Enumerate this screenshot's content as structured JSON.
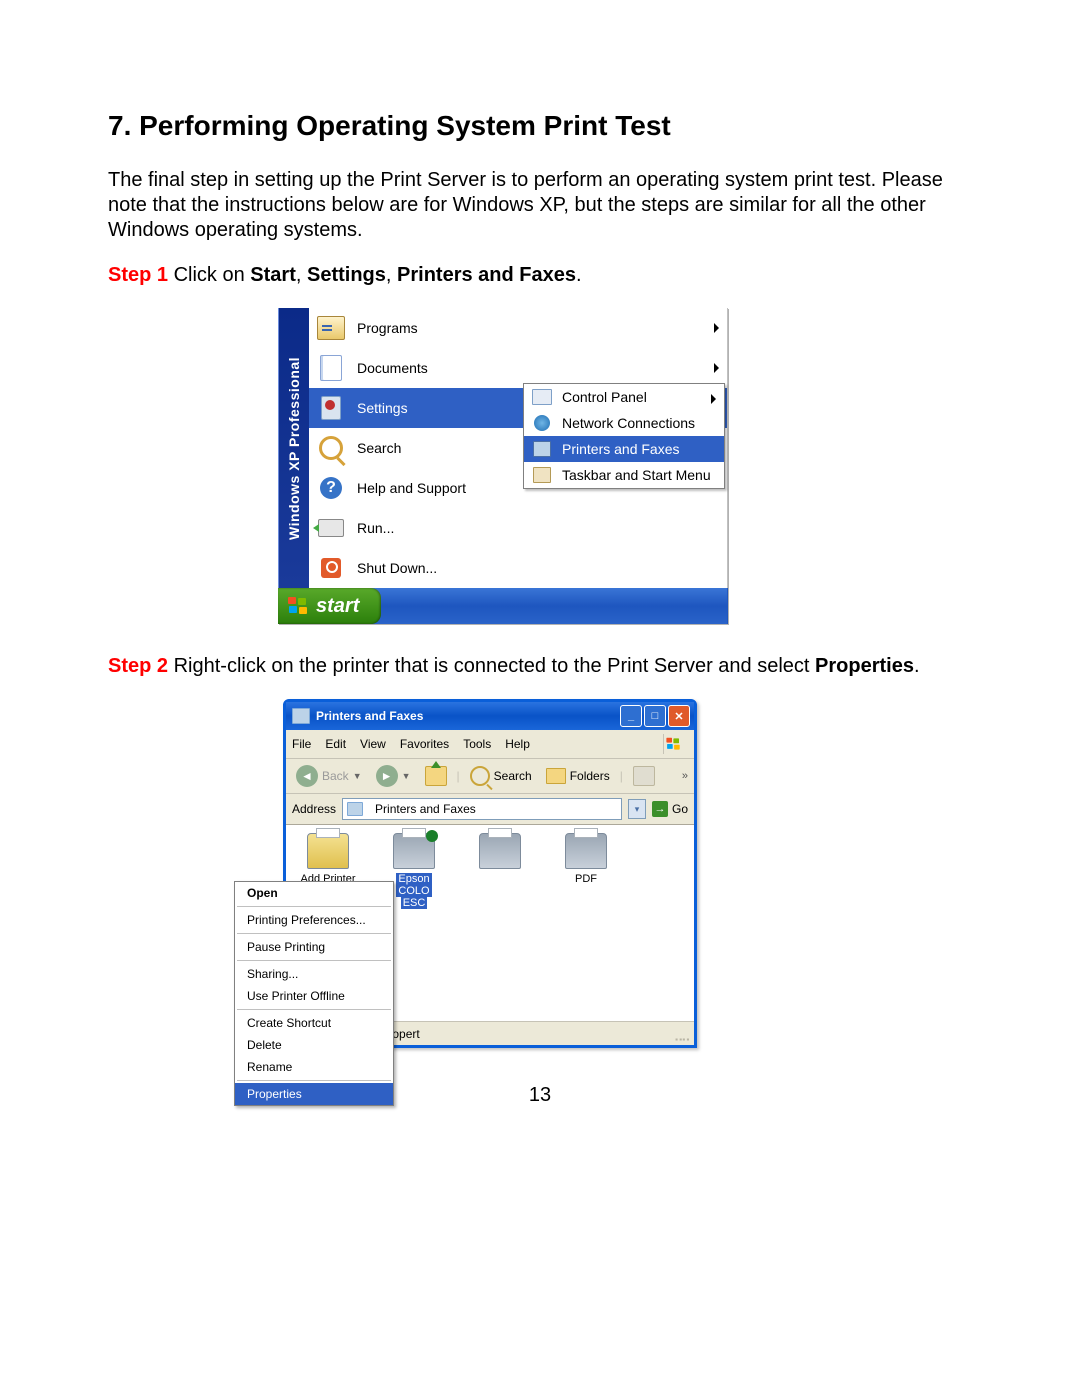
{
  "doc": {
    "heading": "7. Performing Operating System Print Test",
    "intro": "The final step in setting up the Print Server is to perform an operating system print test. Please note that the instructions below are for Windows XP, but the steps are similar for all the other Windows operating systems.",
    "step1_label": "Step 1",
    "step1_body_a": " Click on ",
    "step1_body_b": "Start",
    "step1_body_c": ", ",
    "step1_body_d": "Settings",
    "step1_body_e": ", ",
    "step1_body_f": "Printers and Faxes",
    "step1_body_g": ".",
    "step2_label": "Step 2",
    "step2_body_a": " Right-click on the printer that is connected to the Print Server and select ",
    "step2_body_b": "Properties",
    "step2_body_c": ".",
    "page_number": "13"
  },
  "fig1": {
    "sidebar": "Windows XP  Professional",
    "items": [
      "Programs",
      "Documents",
      "Settings",
      "Search",
      "Help and Support",
      "Run...",
      "Shut Down..."
    ],
    "submenu": [
      "Control Panel",
      "Network Connections",
      "Printers and Faxes",
      "Taskbar and Start Menu"
    ],
    "start": "start"
  },
  "fig2": {
    "title": "Printers and Faxes",
    "menu": [
      "File",
      "Edit",
      "View",
      "Favorites",
      "Tools",
      "Help"
    ],
    "toolbar": {
      "back": "Back",
      "search": "Search",
      "folders": "Folders",
      "overflow": "»"
    },
    "address": {
      "label": "Address",
      "value": "Printers and Faxes",
      "go": "Go"
    },
    "printers": {
      "p0": "Add Printer",
      "p1_line1": "Epson",
      "p1_line2": "COLO",
      "p1_line3": "ESC",
      "p3": "PDF"
    },
    "status": "Displays the propert",
    "context_menu": [
      "Open",
      "Printing Preferences...",
      "Pause Printing",
      "Sharing...",
      "Use Printer Offline",
      "Create Shortcut",
      "Delete",
      "Rename",
      "Properties"
    ]
  }
}
